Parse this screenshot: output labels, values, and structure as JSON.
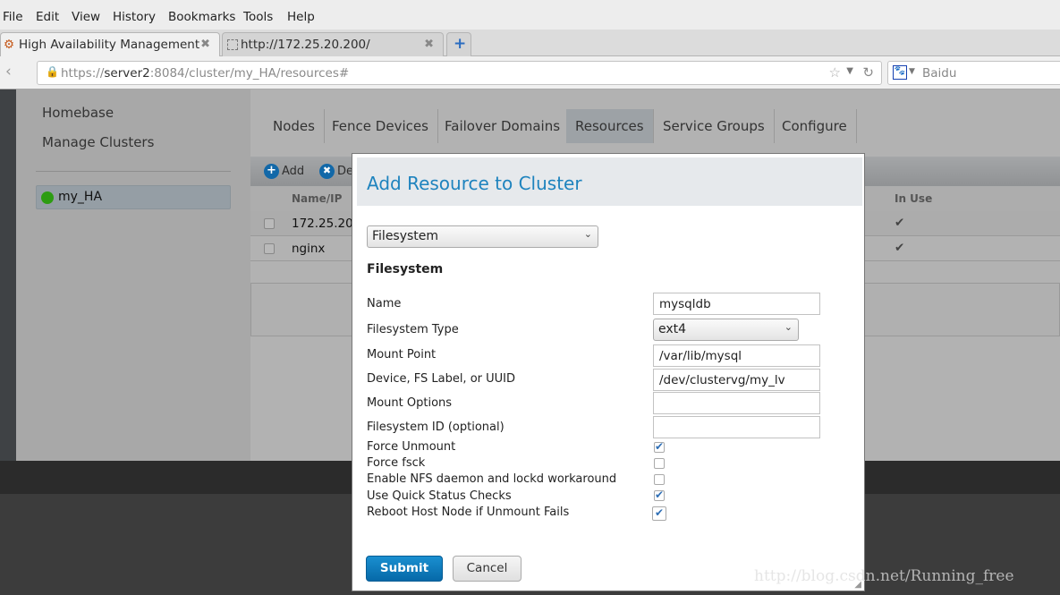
{
  "menubar": [
    "File",
    "Edit",
    "View",
    "History",
    "Bookmarks",
    "Tools",
    "Help"
  ],
  "tabs": [
    {
      "label": "High Availability Management",
      "active": true
    },
    {
      "label": "http://172.25.20.200/",
      "active": false
    }
  ],
  "url": {
    "prefix": "https://",
    "host": "server2",
    "rest": ":8084/cluster/my_HA/resources#"
  },
  "search": {
    "engine": "Baidu"
  },
  "sidebar": {
    "homebase": "Homebase",
    "manage": "Manage Clusters",
    "cluster": "my_HA",
    "cluster_status_color": "#2d9c12"
  },
  "nav_tabs": [
    "Nodes",
    "Fence Devices",
    "Failover Domains",
    "Resources",
    "Service Groups",
    "Configure"
  ],
  "active_nav_tab": "Resources",
  "toolbar": {
    "add": "Add",
    "delete": "De"
  },
  "table": {
    "headers": [
      "Name/IP",
      "In Use"
    ],
    "rows": [
      {
        "name": "172.25.20",
        "in_use": "✔"
      },
      {
        "name": "nginx",
        "in_use": "✔"
      }
    ]
  },
  "dialog": {
    "title": "Add Resource to Cluster",
    "resource_type": "Filesystem",
    "section": "Filesystem",
    "fields": [
      {
        "label": "Name",
        "value": "mysqldb"
      },
      {
        "label": "Filesystem Type",
        "value": "ext4"
      },
      {
        "label": "Mount Point",
        "value": "/var/lib/mysql"
      },
      {
        "label": "Device, FS Label, or UUID",
        "value": "/dev/clustervg/my_lv"
      },
      {
        "label": "Mount Options",
        "value": ""
      },
      {
        "label": "Filesystem ID (optional)",
        "value": ""
      }
    ],
    "checks": [
      {
        "label": "Force Unmount",
        "checked": true
      },
      {
        "label": "Force fsck",
        "checked": false
      },
      {
        "label": "Enable NFS daemon and lockd workaround",
        "checked": false
      },
      {
        "label": "Use Quick Status Checks",
        "checked": true
      },
      {
        "label": "Reboot Host Node if Unmount Fails",
        "checked": true
      }
    ],
    "submit": "Submit",
    "cancel": "Cancel"
  },
  "watermark": "http://blog.csdn.net/Running_free"
}
